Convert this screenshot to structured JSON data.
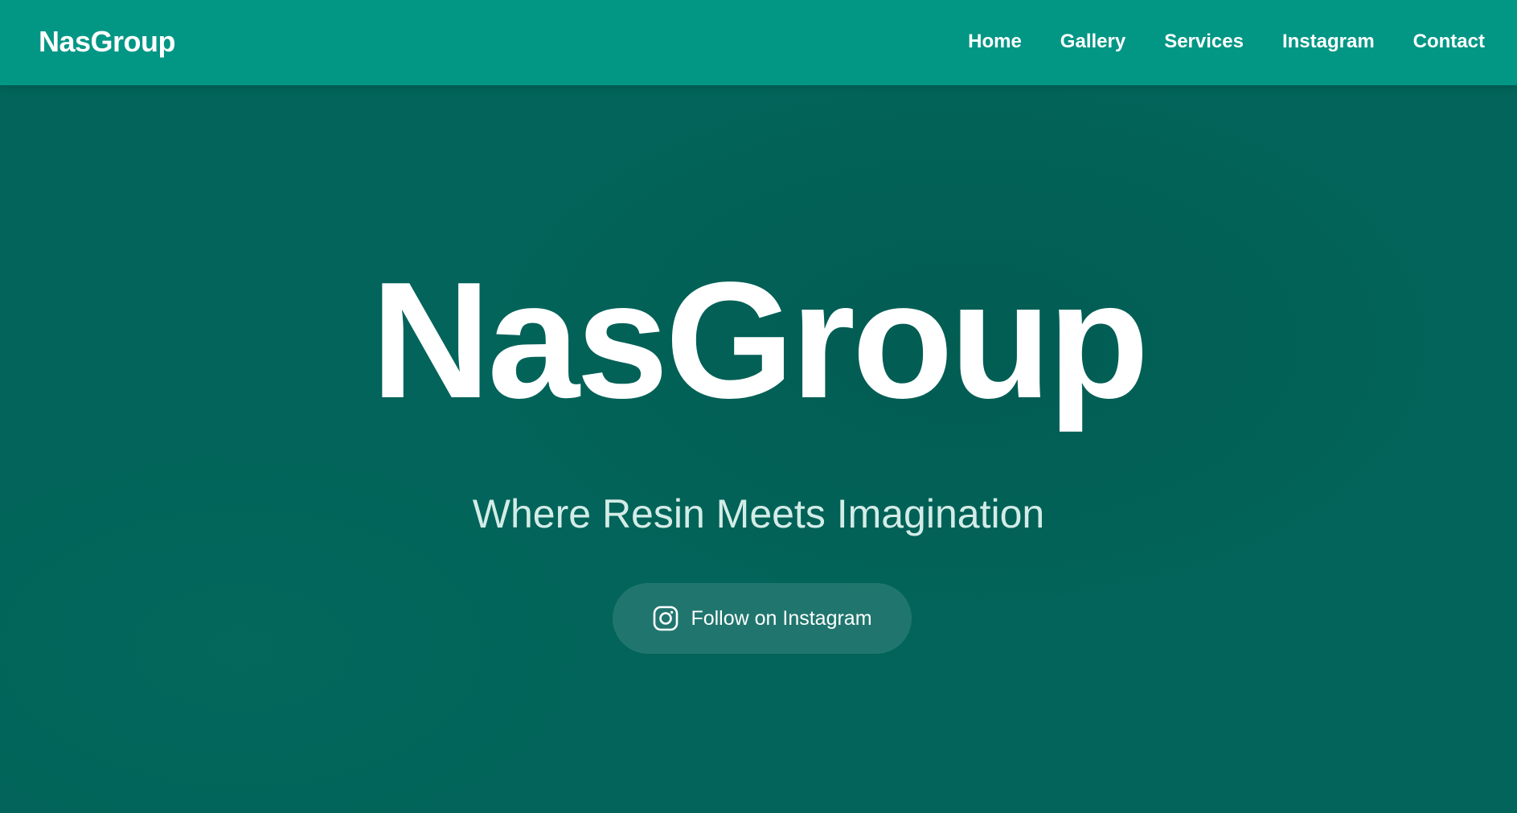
{
  "header": {
    "brand": "NasGroup",
    "nav": [
      {
        "label": "Home"
      },
      {
        "label": "Gallery"
      },
      {
        "label": "Services"
      },
      {
        "label": "Instagram"
      },
      {
        "label": "Contact"
      }
    ]
  },
  "hero": {
    "title": "NasGroup",
    "tagline": "Where Resin Meets Imagination",
    "cta": {
      "label": "Follow on Instagram",
      "icon": "instagram-icon"
    }
  },
  "colors": {
    "header_bg": "#029685",
    "hero_bg": "#02645a",
    "text": "#ffffff",
    "tagline": "#d3ece7"
  }
}
